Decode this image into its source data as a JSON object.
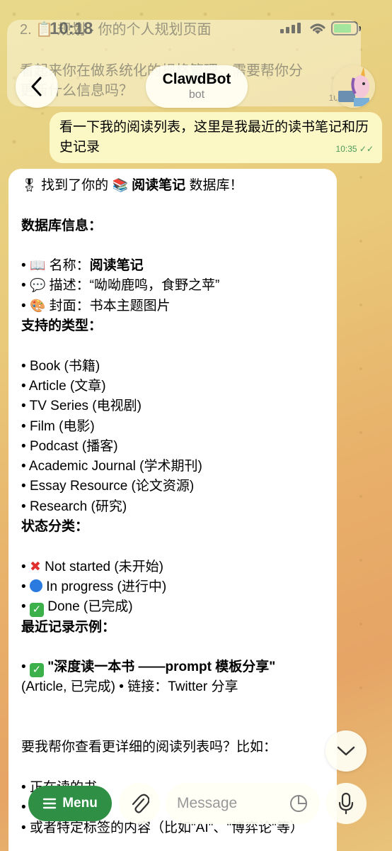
{
  "status_bar": {
    "time": "10:18"
  },
  "previous_message": {
    "line1": "2. 📋 规划 - 你的个人规划页面",
    "line2": "看起来你在做系统化的规格管理，需要帮你分",
    "line3": "更新什么信息吗？",
    "time": "10:3"
  },
  "header": {
    "title": "ClawdBot",
    "subtitle": "bot"
  },
  "outgoing": {
    "text": "看一下我的阅读列表，这里是我最近的读书笔记和历史记录",
    "time": "10:35"
  },
  "incoming": {
    "intro_pre": "找到了你的",
    "intro_name": "阅读笔记",
    "intro_post": "数据库！",
    "db_info_heading": "数据库信息：",
    "name_label": "名称：",
    "name_value": "阅读笔记",
    "desc_label": "描述：",
    "desc_value": "“呦呦鹿鸣，食野之苹”",
    "cover_label": "封面：",
    "cover_value": "书本主题图片",
    "types_heading": "支持的类型：",
    "types": [
      "Book (书籍)",
      "Article (文章)",
      "TV Series (电视剧)",
      "Film (电影)",
      "Podcast (播客)",
      "Academic Journal (学术期刊)",
      "Essay Resource (论文资源)",
      "Research (研究)"
    ],
    "status_heading": "状态分类：",
    "status_not_started": "Not started (未开始)",
    "status_in_progress": "In progress (进行中)",
    "status_done": "Done (已完成)",
    "recent_heading": "最近记录示例：",
    "recent_title": "\"深度读一本书 ——prompt 模板分享\"",
    "recent_meta": "(Article, 已完成) • 链接：Twitter 分享",
    "question": "要我帮你查看更详细的阅读列表吗？比如：",
    "option1": "正在读的书",
    "option2": "",
    "option3": "或者特定标签的内容（比如\"AI\"、\"博弈论\"等）"
  },
  "bottom_bar": {
    "menu_label": "Menu",
    "input_placeholder": "Message"
  },
  "colors": {
    "menu_green": "#2f8f45",
    "outgoing_bubble": "#fcf8c6",
    "read_check": "#4a9a5a"
  }
}
